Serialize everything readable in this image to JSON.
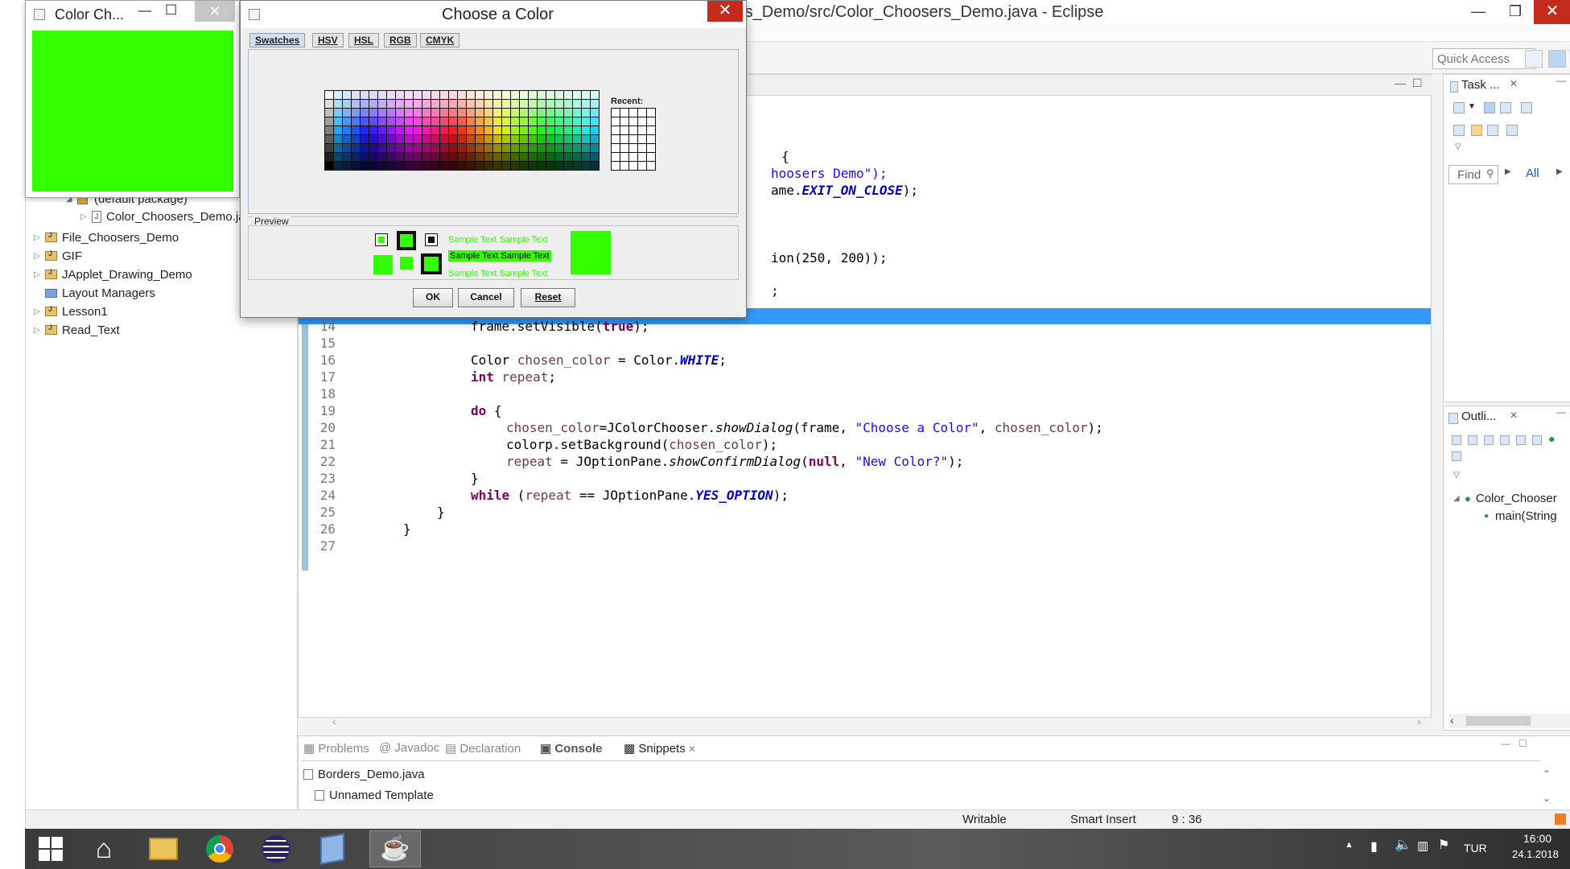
{
  "eclipse": {
    "title": "rs_Demo/src/Color_Choosers_Demo.java - Eclipse",
    "quick_access": "Quick Access",
    "minimize": "—",
    "maximize": "❐",
    "close": "✕"
  },
  "package_explorer": {
    "items": [
      {
        "label": "(default package)",
        "kind": "package"
      },
      {
        "label": "Color_Choosers_Demo.java",
        "kind": "file"
      },
      {
        "label": "File_Choosers_Demo",
        "kind": "project"
      },
      {
        "label": "GIF",
        "kind": "project"
      },
      {
        "label": "JApplet_Drawing_Demo",
        "kind": "project"
      },
      {
        "label": "Layout Managers",
        "kind": "folder"
      },
      {
        "label": "Lesson1",
        "kind": "project"
      },
      {
        "label": "Read_Text",
        "kind": "project"
      }
    ]
  },
  "editor": {
    "line_numbers": [
      "14",
      "15",
      "16",
      "17",
      "18",
      "19",
      "20",
      "21",
      "22",
      "23",
      "24",
      "25",
      "26",
      "27"
    ],
    "code_fragments": {
      "frag1": "{",
      "frag2": "hoosers Demo\");",
      "frag3_a": "ame.",
      "frag3_b": "EXIT_ON_CLOSE",
      "frag3_c": ");",
      "frag4": "ion(250, 200));",
      "frag5": ";"
    },
    "lines": {
      "l14_a": "frame.setVisible(",
      "l14_kw": "true",
      "l14_b": ");",
      "l16_a": "Color ",
      "l16_var": "chosen_color",
      "l16_b": " = Color.",
      "l16_fld": "WHITE",
      "l16_c": ";",
      "l17_kw": "int",
      "l17_var": " repeat",
      "l17_b": ";",
      "l19_kw": "do",
      "l19_b": " {",
      "l20_var": "chosen_color",
      "l20_a": "=JColorChooser.",
      "l20_itl": "showDialog",
      "l20_b": "(frame, ",
      "l20_str": "\"Choose a Color\"",
      "l20_c": ", ",
      "l20_var2": "chosen_color",
      "l20_d": ");",
      "l21_a": "colorp.setBackground(",
      "l21_var": "chosen_color",
      "l21_b": ");",
      "l22_var": "repeat",
      "l22_a": " = JOptionPane.",
      "l22_itl": "showConfirmDialog",
      "l22_b": "(",
      "l22_kw": "null",
      "l22_c": ", ",
      "l22_str": "\"New Color?\"",
      "l22_d": ");",
      "l23": "}",
      "l24_kw": "while",
      "l24_a": " (",
      "l24_var": "repeat",
      "l24_b": " == JOptionPane.",
      "l24_fld": "YES_OPTION",
      "l24_c": ");",
      "l25": "}",
      "l26": "}"
    }
  },
  "task_panel": {
    "title": "Task ...",
    "find_placeholder": "Find",
    "all": "All",
    "a": "A"
  },
  "outline_panel": {
    "title": "Outli...",
    "class_item": "Color_Chooser",
    "method_item": "main(String"
  },
  "bottom_panel": {
    "tabs": [
      "Problems",
      "Javadoc",
      "Declaration",
      "Console",
      "Snippets"
    ],
    "items": [
      "Borders_Demo.java",
      "Unnamed Template"
    ]
  },
  "status": {
    "writable": "Writable",
    "insert_mode": "Smart Insert",
    "position": "9 : 36"
  },
  "color_frame": {
    "title": "Color Ch...",
    "color": "#33ff00",
    "minimize": "—",
    "maximize": "☐",
    "close": "✕"
  },
  "dialog": {
    "title": "Choose a Color",
    "close": "✕",
    "tabs": [
      "Swatches",
      "HSV",
      "HSL",
      "RGB",
      "CMYK"
    ],
    "recent_label": "Recent:",
    "preview_label": "Preview",
    "sample_text": "Sample Text  Sample Text",
    "buttons": {
      "ok": "OK",
      "cancel": "Cancel",
      "reset": "Reset"
    },
    "selected_color": "#33ff00"
  },
  "taskbar": {
    "apps": [
      "start-icon",
      "home-icon",
      "file-explorer-icon",
      "chrome-icon",
      "eclipse-icon",
      "book-icon",
      "java-icon"
    ],
    "lang": "TUR",
    "time": "16:00",
    "date": "24.1.2018"
  }
}
